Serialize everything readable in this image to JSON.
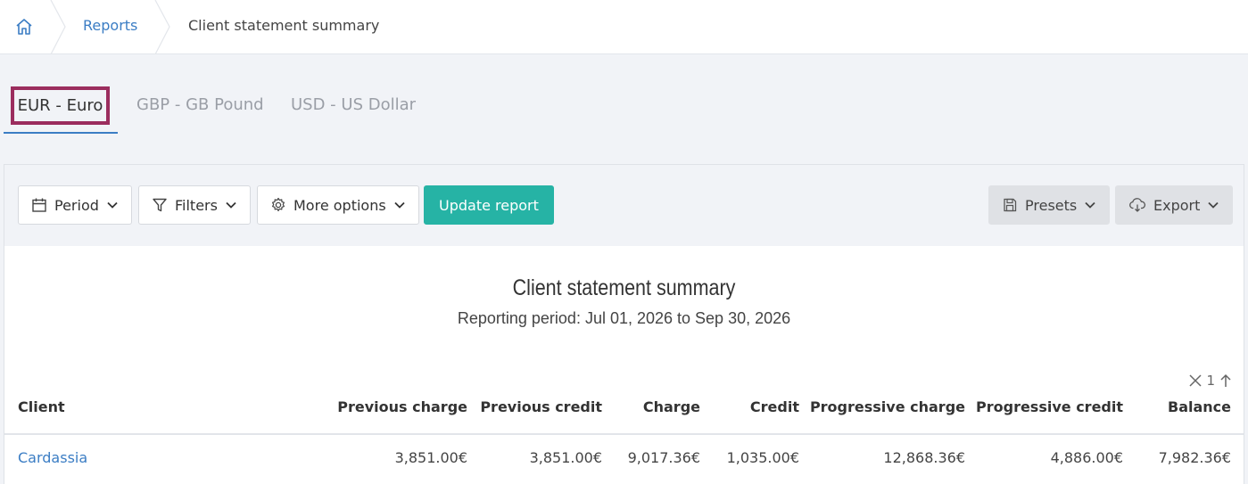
{
  "breadcrumb": {
    "home_icon": "home-icon",
    "reports": "Reports",
    "current": "Client statement summary"
  },
  "tabs": [
    {
      "label": "EUR - Euro",
      "active": true
    },
    {
      "label": "GBP - GB Pound",
      "active": false
    },
    {
      "label": "USD - US Dollar",
      "active": false
    }
  ],
  "toolbar": {
    "period": "Period",
    "filters": "Filters",
    "more_options": "More options",
    "update_report": "Update report",
    "presets": "Presets",
    "export": "Export"
  },
  "report": {
    "title": "Client statement summary",
    "subtitle": "Reporting period: Jul 01, 2026 to Sep 30, 2026"
  },
  "sort": {
    "value": "1"
  },
  "table": {
    "columns": [
      "Client",
      "Previous charge",
      "Previous credit",
      "Charge",
      "Credit",
      "Progressive charge",
      "Progressive credit",
      "Balance"
    ],
    "rows": [
      [
        "Cardassia",
        "3,851.00€",
        "3,851.00€",
        "9,017.36€",
        "1,035.00€",
        "12,868.36€",
        "4,886.00€",
        "7,982.36€"
      ]
    ]
  },
  "colors": {
    "accent": "#26b3a5",
    "link": "#3b7dc4",
    "highlight": "#9b2d5e"
  }
}
